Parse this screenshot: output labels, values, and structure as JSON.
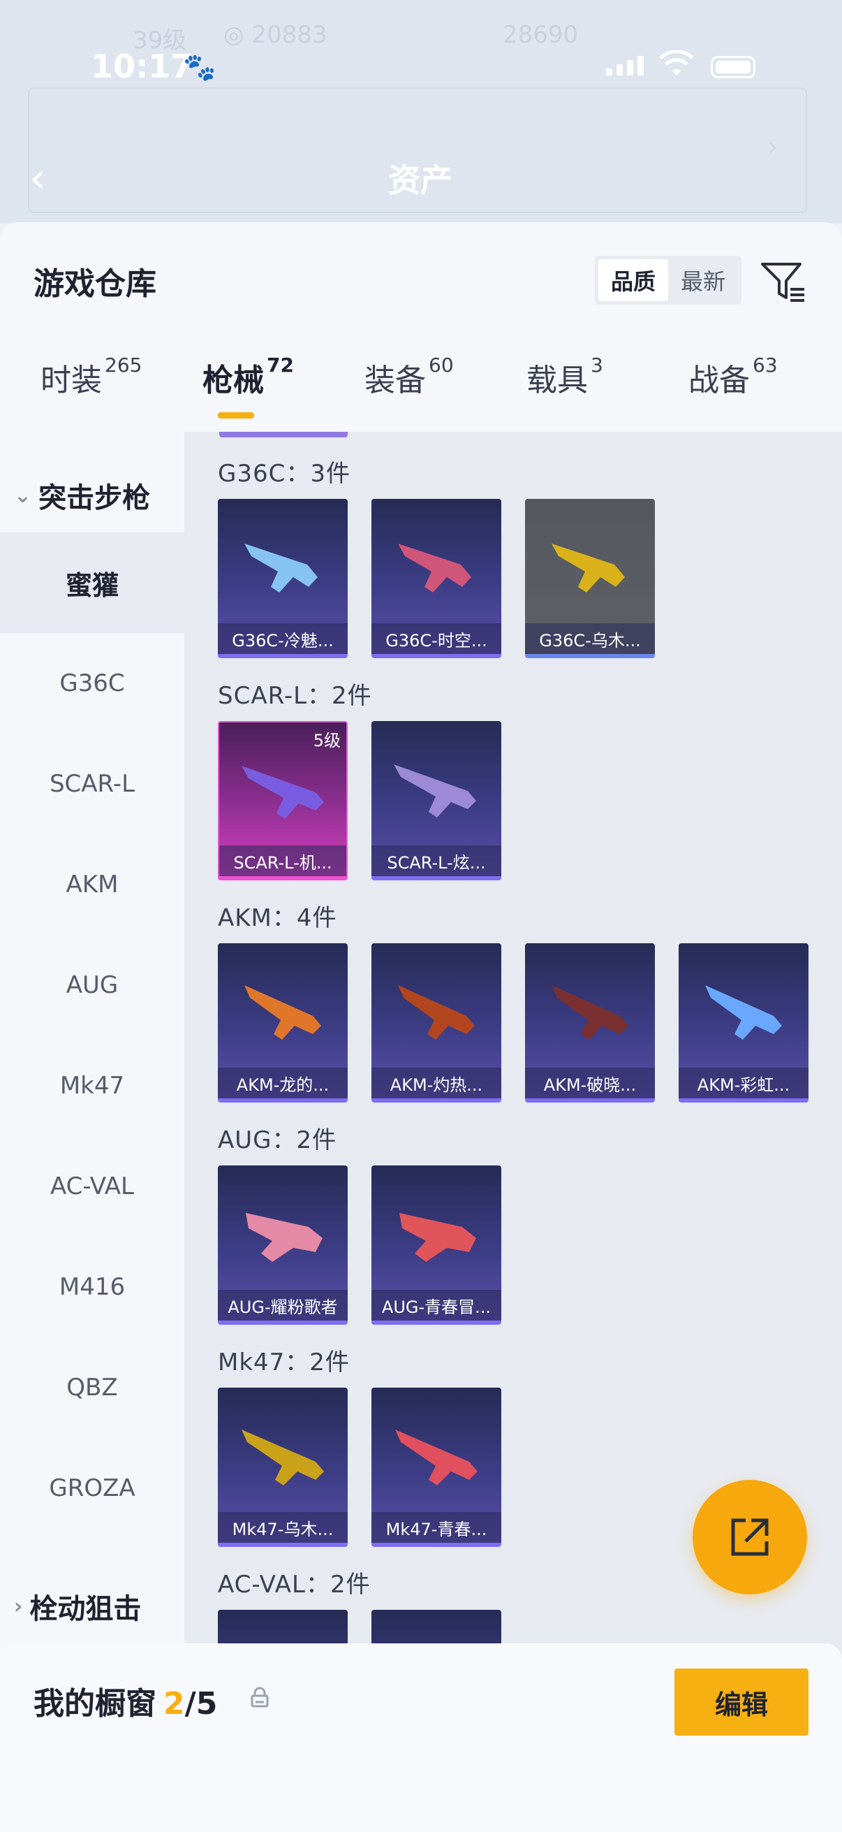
{
  "status_bar": {
    "time": "10:17"
  },
  "background_header": {
    "title": "资产"
  },
  "sheet": {
    "title": "游戏仓库",
    "sort_options": [
      "品质",
      "最新"
    ],
    "active_sort": "品质"
  },
  "tabs": [
    {
      "label": "时装",
      "count": "265"
    },
    {
      "label": "枪械",
      "count": "72"
    },
    {
      "label": "装备",
      "count": "60"
    },
    {
      "label": "载具",
      "count": "3"
    },
    {
      "label": "战备",
      "count": "63"
    }
  ],
  "sidebar": {
    "group_1": "突击步枪",
    "items": [
      "蜜獾",
      "G36C",
      "SCAR-L",
      "AKM",
      "AUG",
      "Mk47",
      "AC-VAL",
      "M416",
      "QBZ",
      "GROZA"
    ],
    "group_2": "栓动狙击"
  },
  "sections": [
    {
      "title": "G36C：3件",
      "items": [
        "G36C-冷魅...",
        "G36C-时空...",
        "G36C-乌木..."
      ]
    },
    {
      "title": "SCAR-L：2件",
      "items": [
        "SCAR-L-机...",
        "SCAR-L-炫..."
      ],
      "badge": "5级"
    },
    {
      "title": "AKM：4件",
      "items": [
        "AKM-龙的...",
        "AKM-灼热...",
        "AKM-破晓...",
        "AKM-彩虹..."
      ]
    },
    {
      "title": "AUG：2件",
      "items": [
        "AUG-耀粉歌者",
        "AUG-青春冒..."
      ]
    },
    {
      "title": "Mk47：2件",
      "items": [
        "Mk47-乌木...",
        "Mk47-青春..."
      ]
    },
    {
      "title": "AC-VAL：2件",
      "items": []
    }
  ],
  "showcase": {
    "title": "我的橱窗",
    "current": "2",
    "total": "/5",
    "edit_label": "编辑"
  },
  "colors": {
    "accent": "#f5b011",
    "purple_card": "#3d3d86",
    "pink_card": "#d43fbd"
  }
}
